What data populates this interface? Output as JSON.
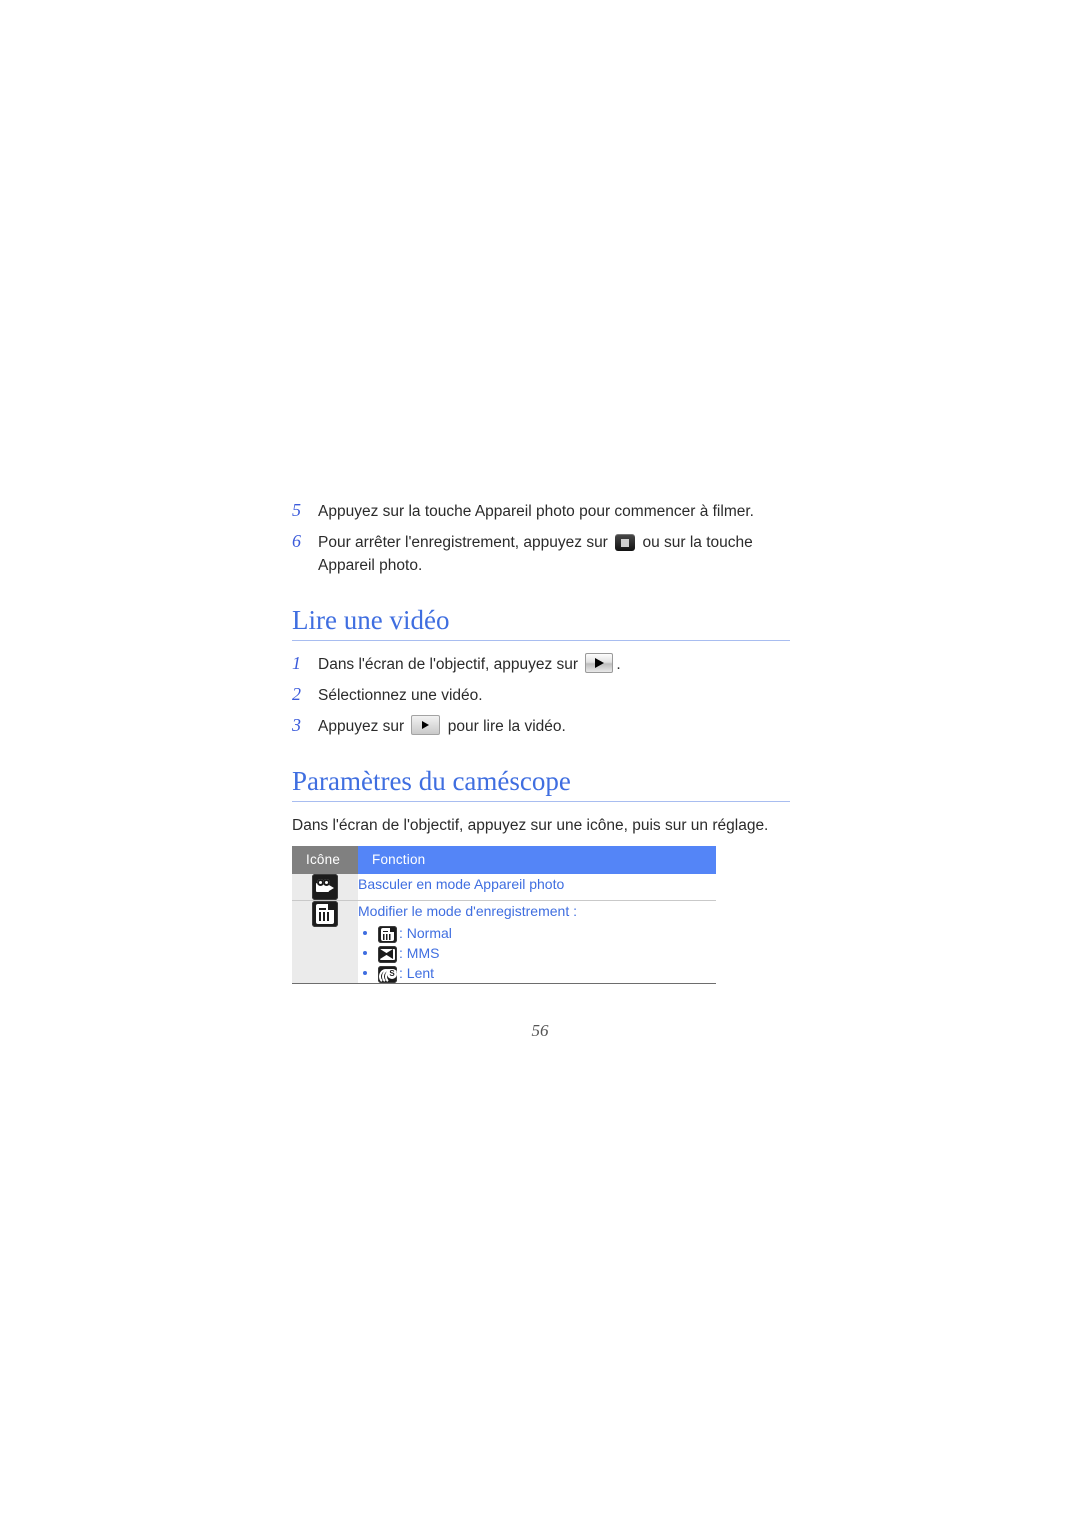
{
  "document": {
    "page_number": "56",
    "language": "fr"
  },
  "steps_top": [
    {
      "number": "5",
      "text_before": "Appuyez sur la touche Appareil photo pour commencer à filmer.",
      "icon": null,
      "text_after": ""
    },
    {
      "number": "6",
      "text_before": "Pour arrêter l'enregistrement, appuyez sur ",
      "icon": "stop-button-icon",
      "text_after": " ou sur la touche Appareil photo."
    }
  ],
  "section_video": {
    "heading": "Lire une vidéo",
    "steps": [
      {
        "number": "1",
        "text_before": "Dans l'écran de l'objectif, appuyez sur ",
        "icon": "play-button-large-icon",
        "text_after": "."
      },
      {
        "number": "2",
        "text_before": "Sélectionnez une vidéo.",
        "icon": null,
        "text_after": ""
      },
      {
        "number": "3",
        "text_before": "Appuyez sur ",
        "icon": "play-button-small-icon",
        "text_after": " pour lire la vidéo."
      }
    ]
  },
  "section_settings": {
    "heading": "Paramètres du caméscope",
    "intro": "Dans l'écran de l'objectif, appuyez sur une icône, puis sur un réglage.",
    "table": {
      "headers": {
        "icon": "Icône",
        "function": "Fonction"
      },
      "header_colors": {
        "icon_bg": "#808080",
        "function_bg": "#5485f7"
      },
      "body_text_color": "#3f6ee0",
      "rows": [
        {
          "icon_name": "camcorder-icon",
          "function_lead": "Basculer en mode Appareil photo",
          "bullets": []
        },
        {
          "icon_name": "recording-mode-icon",
          "function_lead": "Modifier le mode d'enregistrement :",
          "bullets": [
            {
              "icon_name": "recording-normal-icon",
              "label": ": Normal"
            },
            {
              "icon_name": "mms-envelope-icon",
              "label": ": MMS"
            },
            {
              "icon_name": "slow-motion-icon",
              "label": ": Lent"
            }
          ]
        }
      ]
    }
  }
}
